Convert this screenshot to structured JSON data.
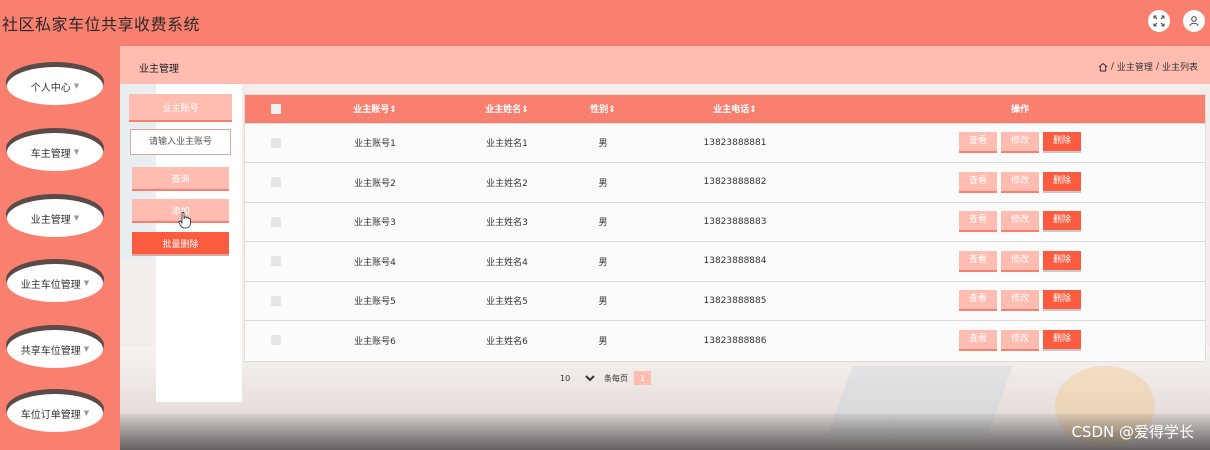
{
  "app": {
    "title": "社区私家车位共享收费系统"
  },
  "topbar": {
    "icons": [
      "fullscreen-icon",
      "user-icon"
    ]
  },
  "sidebar": {
    "items": [
      {
        "label": "个人中心"
      },
      {
        "label": "车主管理"
      },
      {
        "label": "业主管理"
      },
      {
        "label": "业主车位管理"
      },
      {
        "label": "共享车位管理"
      },
      {
        "label": "车位订单管理"
      }
    ]
  },
  "header": {
    "title": "业主管理",
    "breadcrumb": [
      "业主管理",
      "业主列表"
    ],
    "separator": "/"
  },
  "filter": {
    "field_label": "业主账号",
    "input_placeholder": "请输入业主账号",
    "query_label": "查询",
    "add_label": "添加",
    "batch_delete_label": "批量删除"
  },
  "table": {
    "columns": [
      "业主账号",
      "业主姓名",
      "性别",
      "业主电话",
      "操作"
    ],
    "sort_marker": "⇕",
    "rows": [
      {
        "account": "业主账号1",
        "name": "业主姓名1",
        "gender": "男",
        "phone": "13823888881"
      },
      {
        "account": "业主账号2",
        "name": "业主姓名2",
        "gender": "男",
        "phone": "13823888882"
      },
      {
        "account": "业主账号3",
        "name": "业主姓名3",
        "gender": "男",
        "phone": "13823888883"
      },
      {
        "account": "业主账号4",
        "name": "业主姓名4",
        "gender": "男",
        "phone": "13823888884"
      },
      {
        "account": "业主账号5",
        "name": "业主姓名5",
        "gender": "男",
        "phone": "13823888885"
      },
      {
        "account": "业主账号6",
        "name": "业主姓名6",
        "gender": "男",
        "phone": "13823888886"
      }
    ],
    "actions": {
      "view": "查看",
      "edit": "修改",
      "delete": "删除"
    }
  },
  "pagination": {
    "page_size": "10",
    "per_page_label": "条每页",
    "current_page": "1"
  },
  "watermark": "CSDN @爱得学长",
  "colors": {
    "primary": "#f97f6f",
    "light": "#ffbdb2",
    "danger": "#fb5c40"
  }
}
